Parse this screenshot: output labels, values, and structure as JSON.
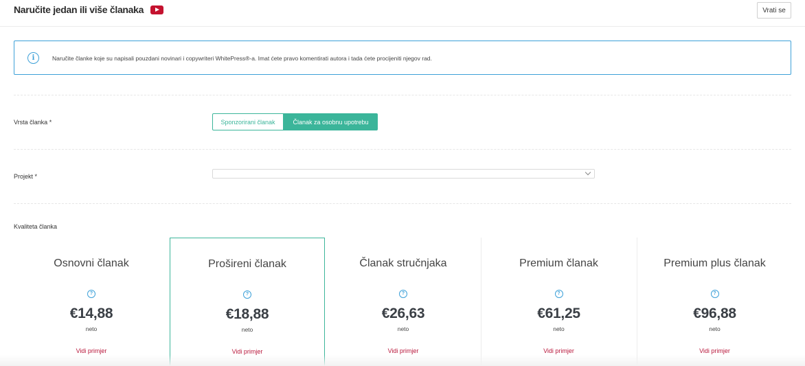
{
  "header": {
    "title": "Naručite jedan ili više članaka",
    "back_label": "Vrati se"
  },
  "info": {
    "text": "Naručite članke koje su napisali pouzdani novinari i copywriteri WhitePress®-a. Imat ćete pravo komentirati autora i tada ćete procijeniti njegov rad."
  },
  "article_type": {
    "label": "Vrsta članka *",
    "options": [
      "Sponzorirani članak",
      "Članak za osobnu upotrebu"
    ],
    "selected": "Članak za osobnu upotrebu"
  },
  "project": {
    "label": "Projekt *",
    "value": ""
  },
  "quality": {
    "label": "Kvaliteta članka",
    "selected": "Prošireni članak",
    "cards": [
      {
        "title": "Osnovni članak",
        "price": "€14,88",
        "unit": "neto",
        "link": "Vidi primjer"
      },
      {
        "title": "Prošireni članak",
        "price": "€18,88",
        "unit": "neto",
        "link": "Vidi primjer"
      },
      {
        "title": "Članak stručnjaka",
        "price": "€26,63",
        "unit": "neto",
        "link": "Vidi primjer"
      },
      {
        "title": "Premium članak",
        "price": "€61,25",
        "unit": "neto",
        "link": "Vidi primjer"
      },
      {
        "title": "Premium plus članak",
        "price": "€96,88",
        "unit": "neto",
        "link": "Vidi primjer"
      }
    ]
  },
  "colors": {
    "accent": "#3bb59a",
    "info_border": "#3ca0d8",
    "link": "#b8173b",
    "youtube": "#c4122f"
  },
  "icons": {
    "video": "youtube-icon",
    "info": "info-icon",
    "help": "question-icon",
    "dropdown": "chevron-down-icon"
  }
}
